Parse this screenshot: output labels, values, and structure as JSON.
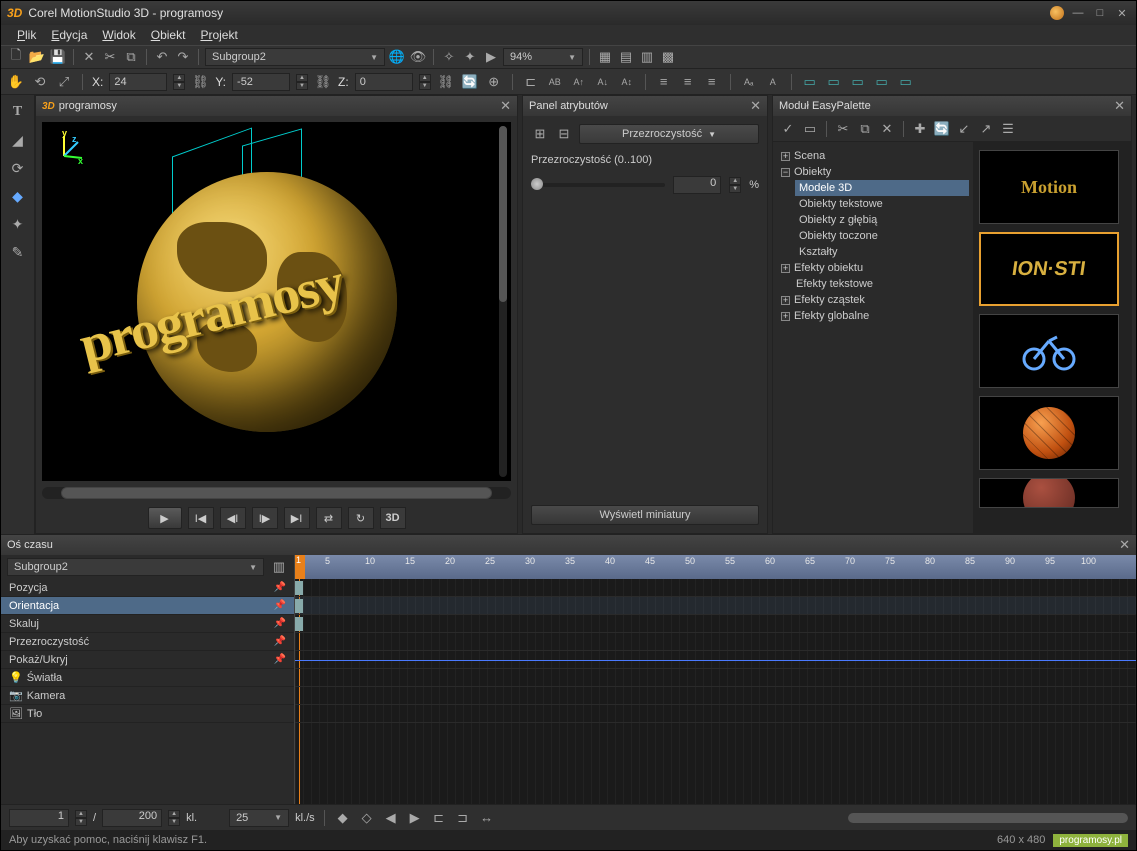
{
  "title": "Corel MotionStudio 3D - programosy",
  "menu": [
    "Plik",
    "Edycja",
    "Widok",
    "Obiekt",
    "Projekt"
  ],
  "tb1": {
    "subgroup": "Subgroup2",
    "zoom": "94%"
  },
  "coords": {
    "x_label": "X:",
    "x": "24",
    "y_label": "Y:",
    "y": "-52",
    "z_label": "Z:",
    "z": "0"
  },
  "preview": {
    "tab": "programosy",
    "text": "programosy",
    "threeD": "3D"
  },
  "attr": {
    "title": "Panel atrybutów",
    "dd": "Przezroczystość",
    "slider_label": "Przezroczystość (0..100)",
    "value": "0",
    "pct": "%",
    "show_btn": "Wyświetl miniatury"
  },
  "easy": {
    "title": "Moduł EasyPalette",
    "tree": {
      "scene": "Scena",
      "objects": "Obiekty",
      "models": "Modele 3D",
      "text_obj": "Obiekty tekstowe",
      "depth_obj": "Obiekty z głębią",
      "turned_obj": "Obiekty toczone",
      "shapes": "Kształty",
      "obj_fx": "Efekty obiektu",
      "text_fx": "Efekty tekstowe",
      "particle_fx": "Efekty cząstek",
      "global_fx": "Efekty globalne"
    }
  },
  "timeline": {
    "title": "Oś czasu",
    "dd": "Subgroup2",
    "tracks": [
      "Pozycja",
      "Orientacja",
      "Skaluj",
      "Przezroczystość",
      "Pokaż/Ukryj",
      "Światła",
      "Kamera",
      "Tło"
    ],
    "selected": "Orientacja",
    "footer": {
      "frame": "1",
      "sep": "/",
      "total": "200",
      "fps_label": "kl.",
      "fps": "25",
      "fps_unit": "kl./s"
    }
  },
  "status": {
    "help": "Aby uzyskać pomoc, naciśnij klawisz F1.",
    "res": "640 x 480",
    "site": "programosy.pl"
  }
}
